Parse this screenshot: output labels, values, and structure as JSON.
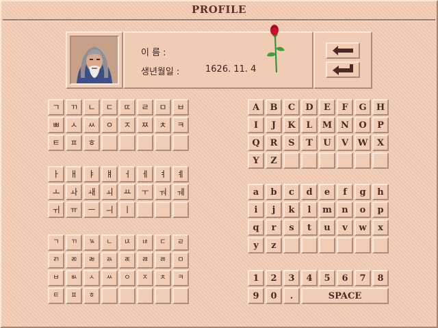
{
  "window": {
    "title": "PROFILE"
  },
  "profile": {
    "name_label": "이   름 :",
    "name_value": "",
    "birth_label": "생년월일 :",
    "birth_value": "1626. 11. 4"
  },
  "buttons": {
    "back": "←",
    "enter": "↵"
  },
  "keyboards": {
    "consonants": [
      [
        "ㄱ",
        "ㄲ",
        "ㄴ",
        "ㄷ",
        "ㄸ",
        "ㄹ",
        "ㅁ",
        "ㅂ"
      ],
      [
        "ㅃ",
        "ㅅ",
        "ㅆ",
        "ㅇ",
        "ㅈ",
        "ㅉ",
        "ㅊ",
        "ㅋ"
      ],
      [
        "ㅌ",
        "ㅍ",
        "ㅎ",
        "",
        "",
        "",
        "",
        ""
      ]
    ],
    "vowels": [
      [
        "ㅏ",
        "ㅐ",
        "ㅑ",
        "ㅒ",
        "ㅓ",
        "ㅔ",
        "ㅕ",
        "ㅖ"
      ],
      [
        "ㅗ",
        "ㅘ",
        "ㅙ",
        "ㅚ",
        "ㅛ",
        "ㅜ",
        "ㅝ",
        "ㅞ"
      ],
      [
        "ㅟ",
        "ㅠ",
        "ㅡ",
        "ㅢ",
        "ㅣ",
        "",
        "",
        ""
      ]
    ],
    "finals": [
      [
        "ㄱ",
        "ㄲ",
        "ㄳ",
        "ㄴ",
        "ㄵ",
        "ㄶ",
        "ㄷ",
        "ㄹ"
      ],
      [
        "ㄺ",
        "ㄻ",
        "ㄼ",
        "ㄽ",
        "ㄾ",
        "ㄿ",
        "ㅀ",
        "ㅁ"
      ],
      [
        "ㅂ",
        "ㅄ",
        "ㅅ",
        "ㅆ",
        "ㅇ",
        "ㅈ",
        "ㅊ",
        "ㅋ"
      ],
      [
        "ㅌ",
        "ㅍ",
        "ㅎ",
        "",
        "",
        "",
        "",
        ""
      ]
    ],
    "upper": [
      [
        "A",
        "B",
        "C",
        "D",
        "E",
        "F",
        "G",
        "H"
      ],
      [
        "I",
        "J",
        "K",
        "L",
        "M",
        "N",
        "O",
        "P"
      ],
      [
        "Q",
        "R",
        "S",
        "T",
        "U",
        "V",
        "W",
        "X"
      ],
      [
        "Y",
        "Z",
        "",
        "",
        "",
        "",
        "",
        ""
      ]
    ],
    "lower": [
      [
        "a",
        "b",
        "c",
        "d",
        "e",
        "f",
        "g",
        "h"
      ],
      [
        "i",
        "j",
        "k",
        "l",
        "m",
        "n",
        "o",
        "p"
      ],
      [
        "q",
        "r",
        "s",
        "t",
        "u",
        "v",
        "w",
        "x"
      ],
      [
        "y",
        "z",
        "",
        "",
        "",
        "",
        "",
        ""
      ]
    ],
    "digits": [
      [
        "1",
        "2",
        "3",
        "4",
        "5",
        "6",
        "7",
        "8"
      ],
      [
        "9",
        "0",
        "."
      ]
    ],
    "space_label": "SPACE"
  }
}
